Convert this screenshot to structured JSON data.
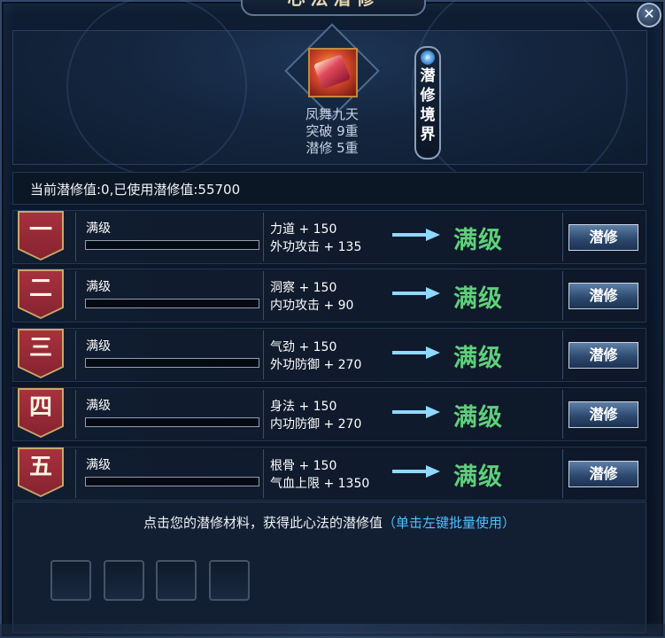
{
  "window": {
    "title": "心法潜修",
    "close_label": "✕"
  },
  "skill": {
    "name": "凤舞九天",
    "breakthrough": "突破 9重",
    "cultivation": "潜修 5重"
  },
  "realm_button": {
    "icon": "search-icon",
    "chars": [
      "潜",
      "修",
      "境",
      "界"
    ]
  },
  "status": {
    "text": "当前潜修值:0,已使用潜修值:55700"
  },
  "rows": [
    {
      "numeral": "一",
      "level_label": "满级",
      "progress": 0,
      "stat1": "力道 + 150",
      "stat2": "外功攻击 + 135",
      "result": "满级",
      "button": "潜修"
    },
    {
      "numeral": "二",
      "level_label": "满级",
      "progress": 0,
      "stat1": "洞察 + 150",
      "stat2": "内功攻击 + 90",
      "result": "满级",
      "button": "潜修"
    },
    {
      "numeral": "三",
      "level_label": "满级",
      "progress": 0,
      "stat1": "气劲 + 150",
      "stat2": "外功防御 + 270",
      "result": "满级",
      "button": "潜修"
    },
    {
      "numeral": "四",
      "level_label": "满级",
      "progress": 0,
      "stat1": "身法 + 150",
      "stat2": "内功防御 + 270",
      "result": "满级",
      "button": "潜修"
    },
    {
      "numeral": "五",
      "level_label": "满级",
      "progress": 0,
      "stat1": "根骨 + 150",
      "stat2": "气血上限 + 1350",
      "result": "满级",
      "button": "潜修"
    }
  ],
  "materials": {
    "hint": "点击您的潜修材料，获得此心法的潜修值",
    "hint_tip": "（单击左键批量使用）",
    "slots": 4
  },
  "colors": {
    "max_green": "#5fd07a",
    "tip_blue": "#4fc0ff",
    "banner_red": "#a8313d"
  }
}
